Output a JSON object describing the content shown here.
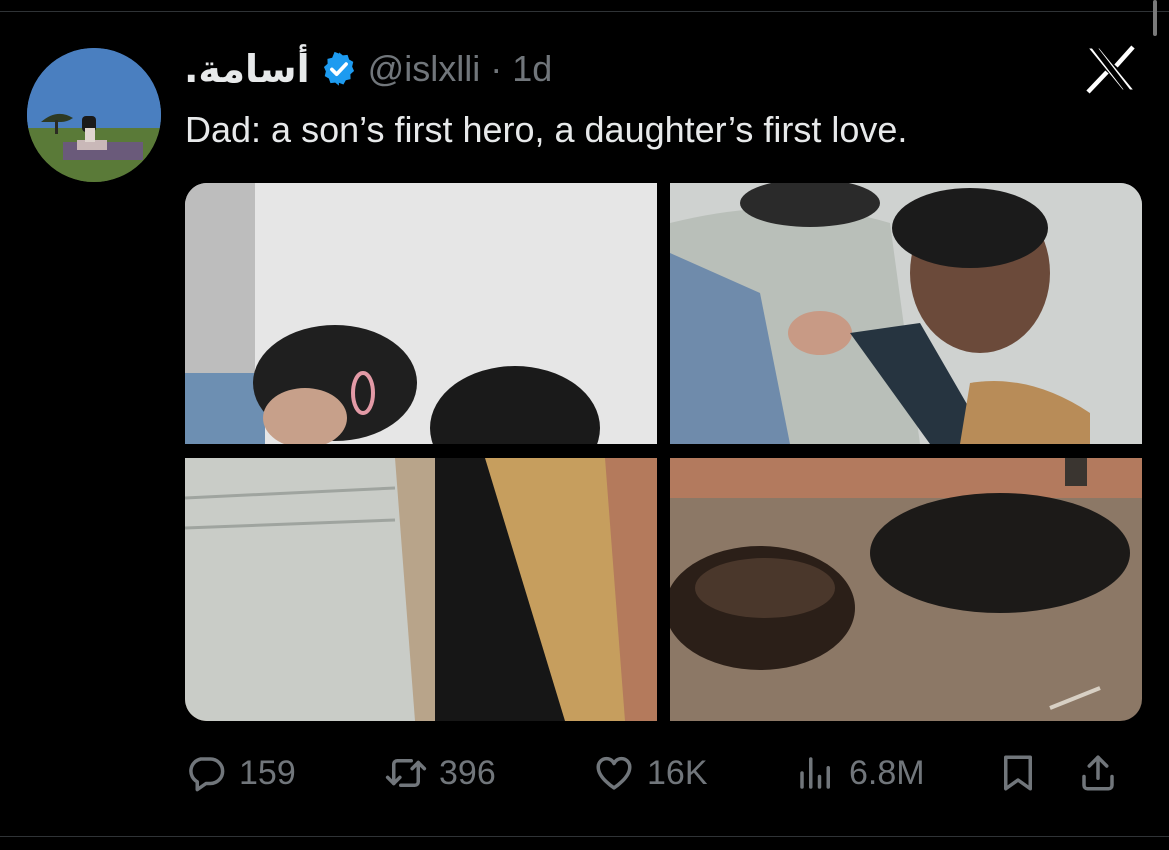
{
  "tweet": {
    "display_name": "أسامة.",
    "handle": "@islxlli",
    "separator": "·",
    "time": "1d",
    "text": "Dad: a son’s first hero, a daughter’s first love."
  },
  "metrics": {
    "replies": "159",
    "reposts": "396",
    "likes": "16K",
    "views": "6.8M"
  },
  "icons": {
    "verified": "verified-badge-icon",
    "logo": "x-logo-icon",
    "reply": "reply-icon",
    "repost": "repost-icon",
    "like": "heart-icon",
    "views": "views-icon",
    "bookmark": "bookmark-icon",
    "share": "share-icon"
  },
  "colors": {
    "background": "#000000",
    "text": "#e7e9ea",
    "secondary": "#71767b",
    "verified": "#1d9bf0"
  }
}
